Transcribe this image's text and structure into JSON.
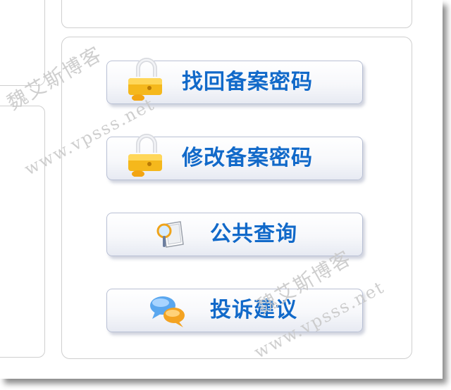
{
  "buttons": [
    {
      "label": "找回备案密码",
      "icon": "lock-icon"
    },
    {
      "label": "修改备案密码",
      "icon": "lock-icon"
    },
    {
      "label": "公共查询",
      "icon": "magnifier-icon"
    },
    {
      "label": "投诉建议",
      "icon": "chat-bubbles-icon"
    }
  ],
  "watermarks": [
    {
      "text": "魏艾斯博客"
    },
    {
      "text": "www.vpsss.net"
    },
    {
      "text": "魏艾斯博客"
    },
    {
      "text": "www.vpsss.net"
    }
  ],
  "colors": {
    "label": "#1169c9",
    "button_border": "#b9c0d4",
    "panel_border": "#cfcfcf",
    "watermark": "#c9c9c9",
    "lock_gold": "#f5b81c"
  }
}
